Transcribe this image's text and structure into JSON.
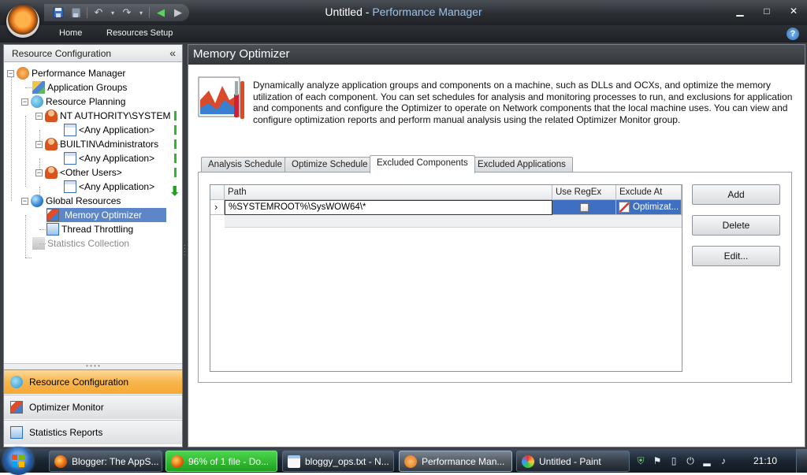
{
  "window": {
    "title_doc": "Untitled",
    "title_sep": " - ",
    "title_app": "Performance Manager",
    "min_glyph": "▁",
    "max_glyph": "□",
    "close_glyph": "✕"
  },
  "ribbon": {
    "tabs": [
      "Home",
      "Resources Setup"
    ],
    "help": "?"
  },
  "left_pane": {
    "title": "Resource Configuration",
    "collapse": "«",
    "tree": [
      {
        "label": "Performance Manager"
      },
      {
        "label": "Application Groups"
      },
      {
        "label": "Resource Planning"
      },
      {
        "label": "NT AUTHORITY\\SYSTEM"
      },
      {
        "label": "<Any Application>"
      },
      {
        "label": "BUILTIN\\Administrators"
      },
      {
        "label": "<Any Application>"
      },
      {
        "label": "<Other Users>"
      },
      {
        "label": "<Any Application>"
      },
      {
        "label": "Global Resources"
      },
      {
        "label": "Memory Optimizer"
      },
      {
        "label": "Thread Throttling"
      },
      {
        "label": "Statistics Collection"
      }
    ],
    "nav": [
      "Resource Configuration",
      "Optimizer Monitor",
      "Statistics Reports"
    ]
  },
  "main": {
    "title": "Memory Optimizer",
    "description": "Dynamically analyze application groups and components on a machine, such as DLLs and OCXs, and optimize the memory utilization of each component.  You can set schedules for analysis and monitoring processes to run, and exclusions for application and components and configure the Optimizer to operate on Network components that the local machine uses. You can view and configure optimization reports and perform manual analysis using the related Optimizer Monitor group.",
    "tabs": [
      "Analysis Schedule",
      "Optimize Schedule",
      "Excluded Components",
      "Excluded Applications"
    ],
    "active_tab": "Excluded Components",
    "grid": {
      "columns": [
        "Path",
        "Use RegEx",
        "Exclude At"
      ],
      "rows": [
        {
          "path": "%SYSTEMROOT%\\SysWOW64\\*",
          "use_regex": false,
          "exclude_at": "Optimizat..."
        }
      ],
      "row_indicator": "›"
    },
    "buttons": {
      "add": "Add",
      "delete": "Delete",
      "edit": "Edit..."
    }
  },
  "taskbar": {
    "tasks": [
      "Blogger: The AppS...",
      "96% of 1 file - Do...",
      "bloggy_ops.txt - N...",
      "Performance Man...",
      "Untitled - Paint"
    ],
    "clock": "21:10"
  },
  "colors": {
    "accent_orange": "#f6a935",
    "selection_blue": "#5c86c8",
    "title_app": "#9cc3ef",
    "indicator_green": "#2eb82e"
  }
}
